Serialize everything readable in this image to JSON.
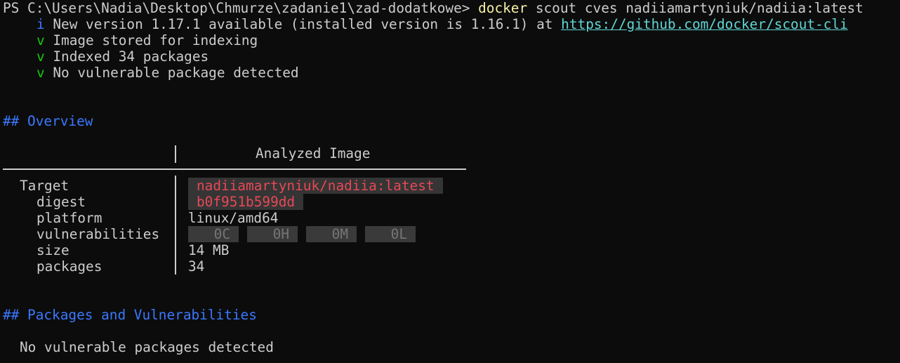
{
  "prompt": {
    "prefix": "PS C:\\Users\\Nadia\\Desktop\\Chmurze\\zadanie1\\zad-dodatkowe> ",
    "command": "docker",
    "args": " scout cves nadiiamartyniuk/nadiia:latest"
  },
  "messages": [
    {
      "marker": "i",
      "text": " New version 1.17.1 available (installed version is 1.16.1) at ",
      "link": "https://github.com/docker/scout-cli"
    },
    {
      "marker": "v",
      "text": " Image stored for indexing"
    },
    {
      "marker": "v",
      "text": " Indexed 34 packages"
    },
    {
      "marker": "v",
      "text": " No vulnerable package detected"
    }
  ],
  "overview": {
    "heading": "## Overview",
    "column_header": "Analyzed Image",
    "target_label": "Target",
    "target_value": "nadiiamartyniuk/nadiia:latest",
    "digest_label": "digest",
    "digest_value": "b0f951b599dd",
    "platform_label": "platform",
    "platform_value": "linux/amd64",
    "vulnerabilities_label": "vulnerabilities",
    "vulnerabilities": [
      "0C",
      "0H",
      "0M",
      "0L"
    ],
    "size_label": "size",
    "size_value": "14 MB",
    "packages_label": "packages",
    "packages_value": "34"
  },
  "packages_section": {
    "heading": "## Packages and Vulnerabilities",
    "message": "No vulnerable packages detected"
  },
  "colors": {
    "background": "#0c0c0c",
    "foreground": "#cccccc",
    "command": "#f9f1a5",
    "heading": "#3b78ff",
    "success": "#16c60c",
    "link": "#61d6d6",
    "highlight_text": "#e74856",
    "highlight_bg": "#353535"
  }
}
